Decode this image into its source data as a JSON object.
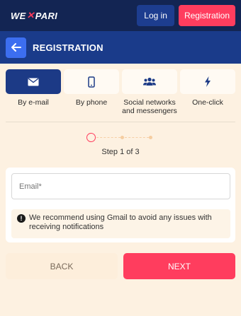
{
  "header": {
    "logo_left": "WE",
    "logo_right": "PARI",
    "login_label": "Log in",
    "register_label": "Registration"
  },
  "titlebar": {
    "title": "REGISTRATION"
  },
  "methods": [
    {
      "label": "By e-mail",
      "icon": "envelope-icon",
      "active": true
    },
    {
      "label": "By phone",
      "icon": "phone-icon",
      "active": false
    },
    {
      "label": "Social networks and messengers",
      "icon": "users-icon",
      "active": false
    },
    {
      "label": "One-click",
      "icon": "lightning-icon",
      "active": false
    }
  ],
  "steps": {
    "current": 1,
    "total": 3,
    "text": "Step 1 of 3"
  },
  "form": {
    "email_placeholder": "Email*",
    "notice": "We recommend using Gmail to avoid any issues with receiving notifications"
  },
  "actions": {
    "back_label": "BACK",
    "next_label": "NEXT"
  },
  "colors": {
    "header_bg": "#132553",
    "titlebar_bg": "#1a3b8a",
    "accent": "#ff3d5e",
    "page_bg": "#fdf1e1"
  }
}
